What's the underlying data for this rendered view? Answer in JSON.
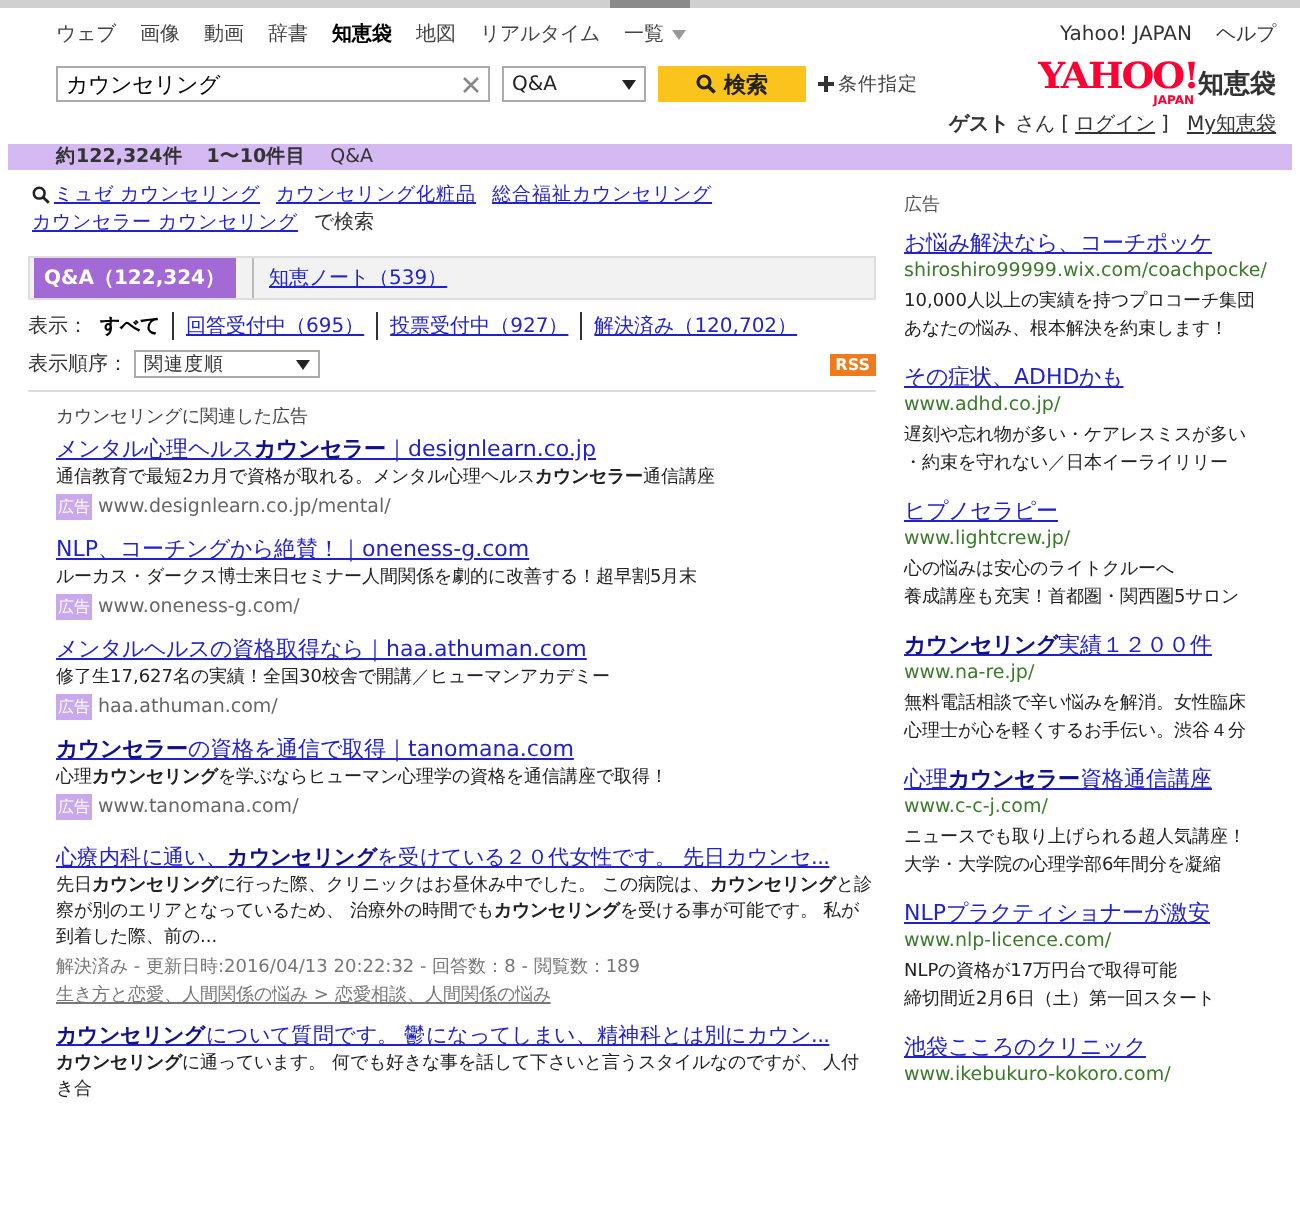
{
  "nav": {
    "items": [
      {
        "label": "ウェブ",
        "selected": false
      },
      {
        "label": "画像",
        "selected": false
      },
      {
        "label": "動画",
        "selected": false
      },
      {
        "label": "辞書",
        "selected": false
      },
      {
        "label": "知恵袋",
        "selected": true
      },
      {
        "label": "地図",
        "selected": false
      },
      {
        "label": "リアルタイム",
        "selected": false
      }
    ],
    "more": "一覧",
    "right_links": [
      "Yahoo! JAPAN",
      "ヘルプ"
    ]
  },
  "search": {
    "value": "カウンセリング",
    "scope": "Q&A",
    "button": "検索",
    "advanced": "条件指定"
  },
  "logo": {
    "brand": "YAHOO!",
    "sub": "JAPAN",
    "service": "知恵袋"
  },
  "user": {
    "name": "ゲスト",
    "suffix": "さん",
    "open": "[",
    "login": "ログイン",
    "close": "]",
    "my": "My知恵袋"
  },
  "summary": {
    "count": "約122,324件",
    "range": "1〜10件目",
    "type": "Q&A"
  },
  "related": {
    "links": [
      "ミュゼ カウンセリング",
      "カウンセリング化粧品",
      "総合福祉カウンセリング",
      "カウンセラー カウンセリング"
    ],
    "suffix": "で検索"
  },
  "tabs": [
    {
      "label": "Q&A（122,324）",
      "selected": true
    },
    {
      "label": "知恵ノート（539）",
      "selected": false
    }
  ],
  "filter": {
    "label": "表示：",
    "options": [
      {
        "label": "すべて",
        "selected": true
      },
      {
        "label": "回答受付中（695）",
        "selected": false
      },
      {
        "label": "投票受付中（927）",
        "selected": false
      },
      {
        "label": "解決済み（120,702）",
        "selected": false
      }
    ]
  },
  "sort": {
    "label": "表示順序：",
    "value": "関連度順",
    "rss": "RSS"
  },
  "ads": {
    "heading": "カウンセリングに関連した広告",
    "items": [
      {
        "title": "メンタル心理ヘルス**カウンセラー**｜designlearn.co.jp",
        "desc": "通信教育で最短2カ月で資格が取れる。メンタル心理ヘルス**カウンセラー**通信講座",
        "badge": "広告",
        "url": "www.designlearn.co.jp/mental/"
      },
      {
        "title": "NLP、コーチングから絶賛！｜oneness-g.com",
        "desc": "ルーカス・ダークス博士来日セミナー人間関係を劇的に改善する！超早割5月末",
        "badge": "広告",
        "url": "www.oneness-g.com/"
      },
      {
        "title": "メンタルヘルスの資格取得なら｜haa.athuman.com",
        "desc": "修了生17,627名の実績！全国30校舎で開講／ヒューマンアカデミー",
        "badge": "広告",
        "url": "haa.athuman.com/"
      },
      {
        "title": "**カウンセラー**の資格を通信で取得｜tanomana.com",
        "desc": "心理**カウンセリング**を学ぶならヒューマン心理学の資格を通信講座で取得！",
        "badge": "広告",
        "url": "www.tanomana.com/"
      }
    ]
  },
  "results": [
    {
      "title": "心療内科に通い、**カウンセリング**を受けている２０代女性です。 先日カウンセ...",
      "desc": "先日**カウンセリング**に行った際、クリニックはお昼休み中でした。 この病院は、**カウンセリング**と診察が別のエリアとなっているため、 治療外の時間でも**カウンセリング**を受ける事が可能です。 私が到着した際、前の...",
      "meta": "解決済み - 更新日時:2016/04/13 20:22:32 - 回答数：8 - 閲覧数：189",
      "category": "生き方と恋愛、人間関係の悩み > 恋愛相談、人間関係の悩み"
    },
    {
      "title": "**カウンセリング**について質問です。 鬱になってしまい、精神科とは別にカウン...",
      "desc": "**カウンセリング**に通っています。 何でも好きな事を話して下さいと言うスタイルなのですが、 人付き合"
    }
  ],
  "side_ads": {
    "heading": "広告",
    "items": [
      {
        "title": "お悩み解決なら、コーチポッケ",
        "url": "shiroshiro99999.wix.com/coachpocke/",
        "lines": [
          "10,000人以上の実績を持つプロコーチ集団",
          "あなたの悩み、根本解決を約束します！"
        ]
      },
      {
        "title": "その症状、ADHDかも",
        "url": "www.adhd.co.jp/",
        "lines": [
          "遅刻や忘れ物が多い・ケアレスミスが多い",
          "・約束を守れない／日本イーライリリー"
        ]
      },
      {
        "title": "ヒプノセラピー",
        "url": "www.lightcrew.jp/",
        "lines": [
          "心の悩みは安心のライトクルーへ",
          "養成講座も充実！首都圏・関西圏5サロン"
        ]
      },
      {
        "title": "**カウンセリング**実績１２００件",
        "url": "www.na-re.jp/",
        "lines": [
          "無料電話相談で辛い悩みを解消。女性臨床",
          "心理士が心を軽くするお手伝い。渋谷４分"
        ]
      },
      {
        "title": "心理**カウンセラー**資格通信講座",
        "url": "www.c-c-j.com/",
        "lines": [
          "ニュースでも取り上げられる超人気講座！",
          "大学・大学院の心理学部6年間分を凝縮"
        ]
      },
      {
        "title": "NLPプラクティショナーが激安",
        "url": "www.nlp-licence.com/",
        "lines": [
          "NLPの資格が17万円台で取得可能",
          "締切間近2月6日（土）第一回スタート"
        ]
      },
      {
        "title": "池袋こころのクリニック",
        "url": "www.ikebukuro-kokoro.com/"
      }
    ]
  }
}
